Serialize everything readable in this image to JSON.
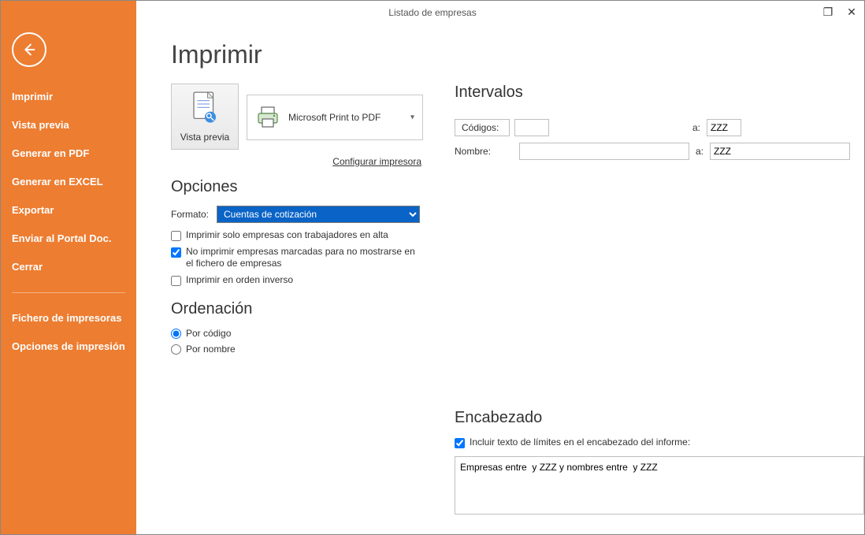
{
  "window": {
    "title": "Listado de empresas"
  },
  "sidebar": {
    "items": [
      "Imprimir",
      "Vista previa",
      "Generar en PDF",
      "Generar en EXCEL",
      "Exportar",
      "Enviar al Portal Doc.",
      "Cerrar"
    ],
    "items2": [
      "Fichero de impresoras",
      "Opciones de impresión"
    ]
  },
  "main": {
    "page_title": "Imprimir",
    "vista_previa_label": "Vista previa",
    "printer_name": "Microsoft Print to PDF",
    "config_link": "Configurar impresora",
    "opciones": {
      "title": "Opciones",
      "formato_label": "Formato:",
      "formato_selected": "Cuentas de cotización",
      "chk_solo_alta": "Imprimir solo empresas con trabajadores en alta",
      "chk_no_mostrar": "No imprimir empresas marcadas para no mostrarse en el fichero de empresas",
      "chk_inverso": "Imprimir en orden inverso"
    },
    "ordenacion": {
      "title": "Ordenación",
      "por_codigo": "Por código",
      "por_nombre": "Por nombre"
    },
    "intervalos": {
      "title": "Intervalos",
      "codigos_label": "Códigos:",
      "nombre_label": "Nombre:",
      "a_label": "a:",
      "codigos_from": "",
      "codigos_to": "ZZZ",
      "nombre_from": "",
      "nombre_to": "ZZZ"
    },
    "encabezado": {
      "title": "Encabezado",
      "chk_incluir": "Incluir texto de límites en el encabezado del informe:",
      "text": "Empresas entre  y ZZZ y nombres entre  y ZZZ"
    }
  }
}
